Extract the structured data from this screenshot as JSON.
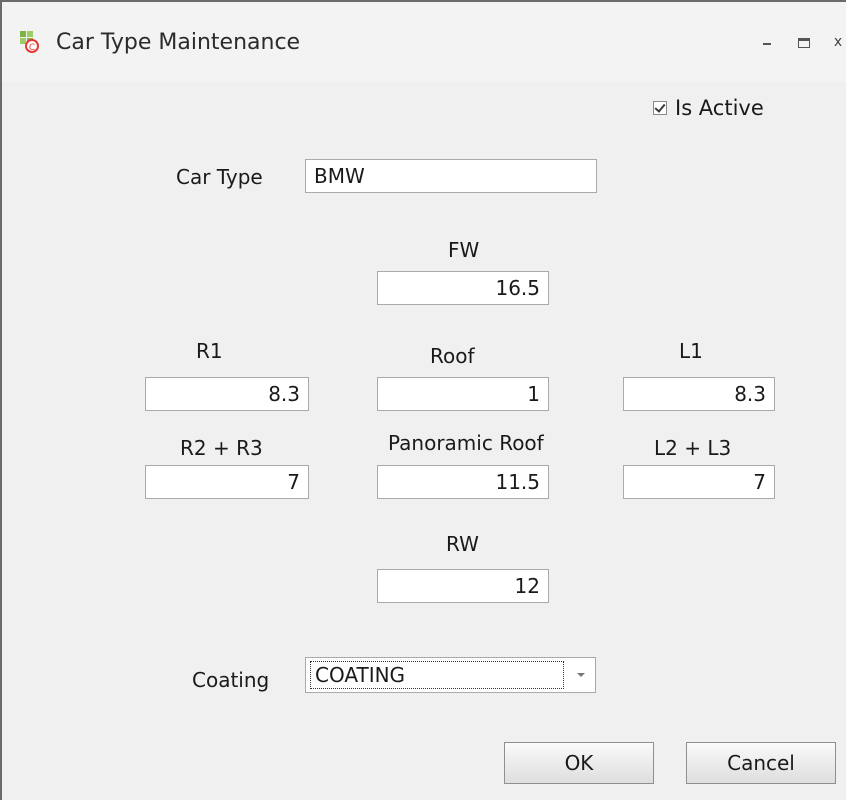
{
  "window": {
    "title": "Car Type Maintenance",
    "controls": {
      "minimize": "–",
      "maximize": "□",
      "close": "x"
    }
  },
  "form": {
    "is_active": {
      "label": "Is Active",
      "checked": true
    },
    "car_type": {
      "label": "Car Type",
      "value": "BMW"
    },
    "fw": {
      "label": "FW",
      "value": "16.5"
    },
    "r1": {
      "label": "R1",
      "value": "8.3"
    },
    "roof": {
      "label": "Roof",
      "value": "1"
    },
    "l1": {
      "label": "L1",
      "value": "8.3"
    },
    "r2_r3": {
      "label": "R2 + R3",
      "value": "7"
    },
    "panoramic_roof": {
      "label": "Panoramic Roof",
      "value": "11.5"
    },
    "l2_l3": {
      "label": "L2 + L3",
      "value": "7"
    },
    "rw": {
      "label": "RW",
      "value": "12"
    },
    "coating": {
      "label": "Coating",
      "value": "COATING"
    }
  },
  "buttons": {
    "ok": "OK",
    "cancel": "Cancel"
  }
}
